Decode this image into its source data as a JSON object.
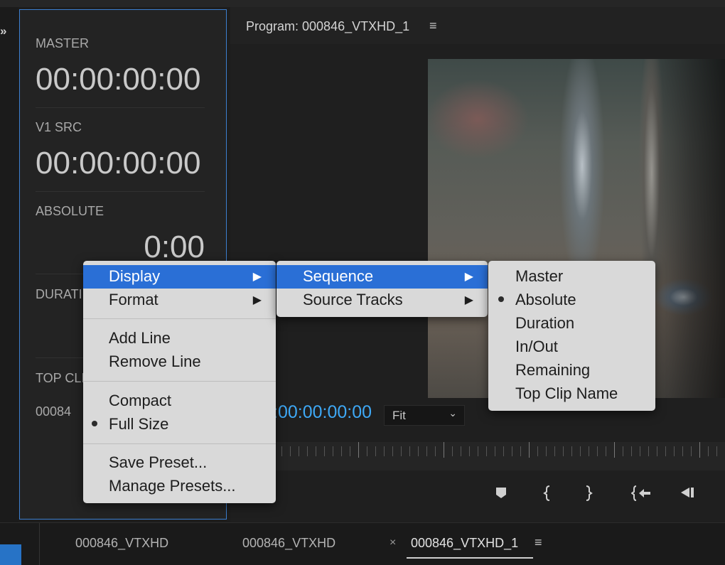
{
  "left_edge": {
    "expand_icon": "»"
  },
  "timecode_panel": {
    "sections": [
      {
        "label": "MASTER",
        "value": "00:00:00:00"
      },
      {
        "label": "V1 SRC",
        "value": "00:00:00:00"
      },
      {
        "label": "ABSOLUTE",
        "value": "0:00"
      },
      {
        "label": "DURATI"
      },
      {
        "label": "TOP CLI",
        "value": "00084"
      }
    ]
  },
  "program_monitor": {
    "title": "Program: 000846_VTXHD_1",
    "menu_icon": "≡",
    "timecode": ":00:00:00:00",
    "fit": {
      "selected": "Fit",
      "chevron_icon": "chevron-down-icon"
    },
    "transport_icons": [
      "add-marker-icon",
      "mark-in-icon",
      "mark-out-icon",
      "go-to-in-icon",
      "step-back-icon"
    ]
  },
  "tabs": [
    {
      "label": "000846_VTXHD",
      "active": false
    },
    {
      "label": "000846_VTXHD",
      "active": false
    },
    {
      "label": "000846_VTXHD_1",
      "active": true,
      "close": "×",
      "menu": "≡"
    }
  ],
  "menus": {
    "main": {
      "items": [
        {
          "label": "Display",
          "submenu": true,
          "highlighted": true
        },
        {
          "label": "Format",
          "submenu": true
        },
        {
          "label": "Add Line"
        },
        {
          "label": "Remove Line"
        },
        {
          "label": "Compact"
        },
        {
          "label": "Full Size",
          "checked": true
        },
        {
          "label": "Save Preset..."
        },
        {
          "label": "Manage Presets..."
        }
      ]
    },
    "display": {
      "items": [
        {
          "label": "Sequence",
          "submenu": true,
          "highlighted": true
        },
        {
          "label": "Source Tracks",
          "submenu": true
        }
      ]
    },
    "sequence": {
      "items": [
        {
          "label": "Master"
        },
        {
          "label": "Absolute",
          "checked": true
        },
        {
          "label": "Duration"
        },
        {
          "label": "In/Out"
        },
        {
          "label": "Remaining"
        },
        {
          "label": "Top Clip Name"
        }
      ]
    },
    "submenu_arrow": "▶"
  },
  "colors": {
    "accent_blue": "#3ea8f5",
    "selection": "#2a6fd6",
    "panel_border": "#3c7fd0"
  }
}
